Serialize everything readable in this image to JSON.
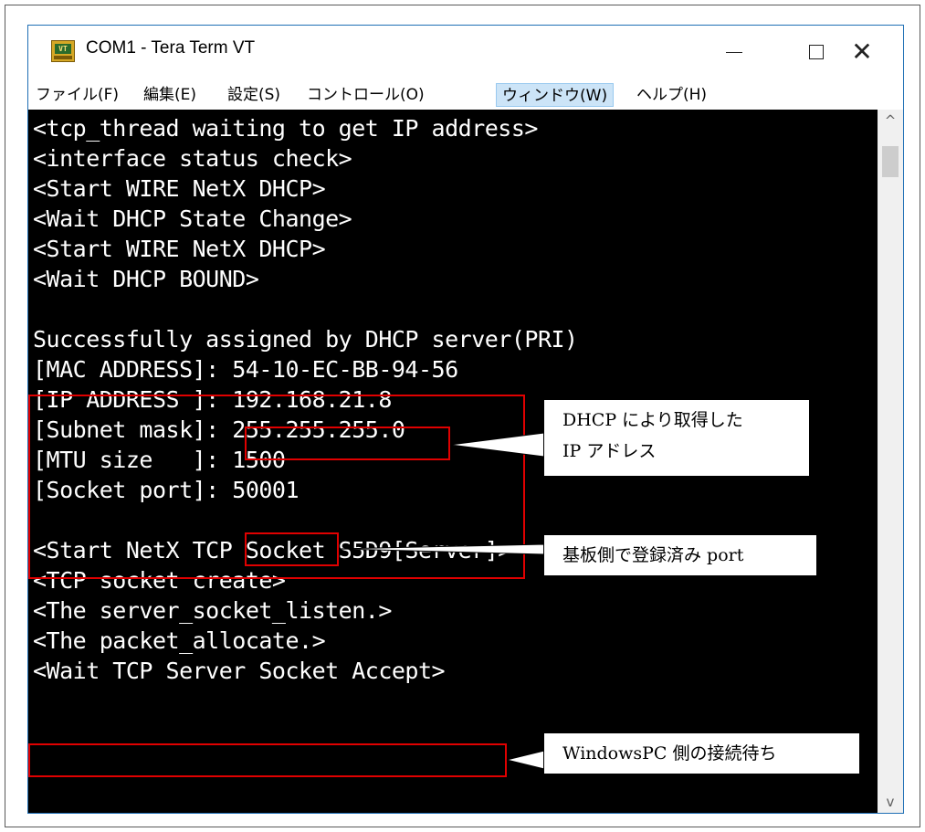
{
  "window": {
    "title": "COM1 - Tera Term VT",
    "icon_label": "VT",
    "controls": {
      "minimize": "—",
      "maximize": "□",
      "close": "✕"
    }
  },
  "menu": [
    {
      "label": "ファイル(F)"
    },
    {
      "label": "編集(E)"
    },
    {
      "label": "設定(S)"
    },
    {
      "label": "コントロール(O)"
    },
    {
      "label": "ウィンドウ(W)",
      "active": true
    },
    {
      "label": "ヘルプ(H)"
    }
  ],
  "terminal": {
    "background": "#000000",
    "text_color": "#ffffff",
    "lines": [
      "<tcp_thread waiting to get IP address>",
      "<interface status check>",
      "<Start WIRE NetX DHCP>",
      "<Wait DHCP State Change>",
      "<Start WIRE NetX DHCP>",
      "<Wait DHCP BOUND>",
      "",
      "Successfully assigned by DHCP server(PRI)",
      "[MAC ADDRESS]: 54-10-EC-BB-94-56",
      "[IP ADDRESS ]: 192.168.21.8",
      "[Subnet mask]: 255.255.255.0",
      "[MTU size   ]: 1500",
      "[Socket port]: 50001",
      "",
      "<Start NetX TCP Socket S5D9[Server]>",
      "<TCP socket create>",
      "<The server_socket_listen.>",
      "<The packet_allocate.>",
      "<Wait TCP Server Socket Accept>"
    ]
  },
  "scrollbar": {
    "up_icon": "^",
    "down_icon": "v"
  },
  "annotations": {
    "highlight_color": "#e00000",
    "dhcp_ip": [
      "DHCP により取得した",
      "IP アドレス"
    ],
    "port": "基板側で登録済み port",
    "wait": "WindowsPC 側の接続待ち"
  }
}
